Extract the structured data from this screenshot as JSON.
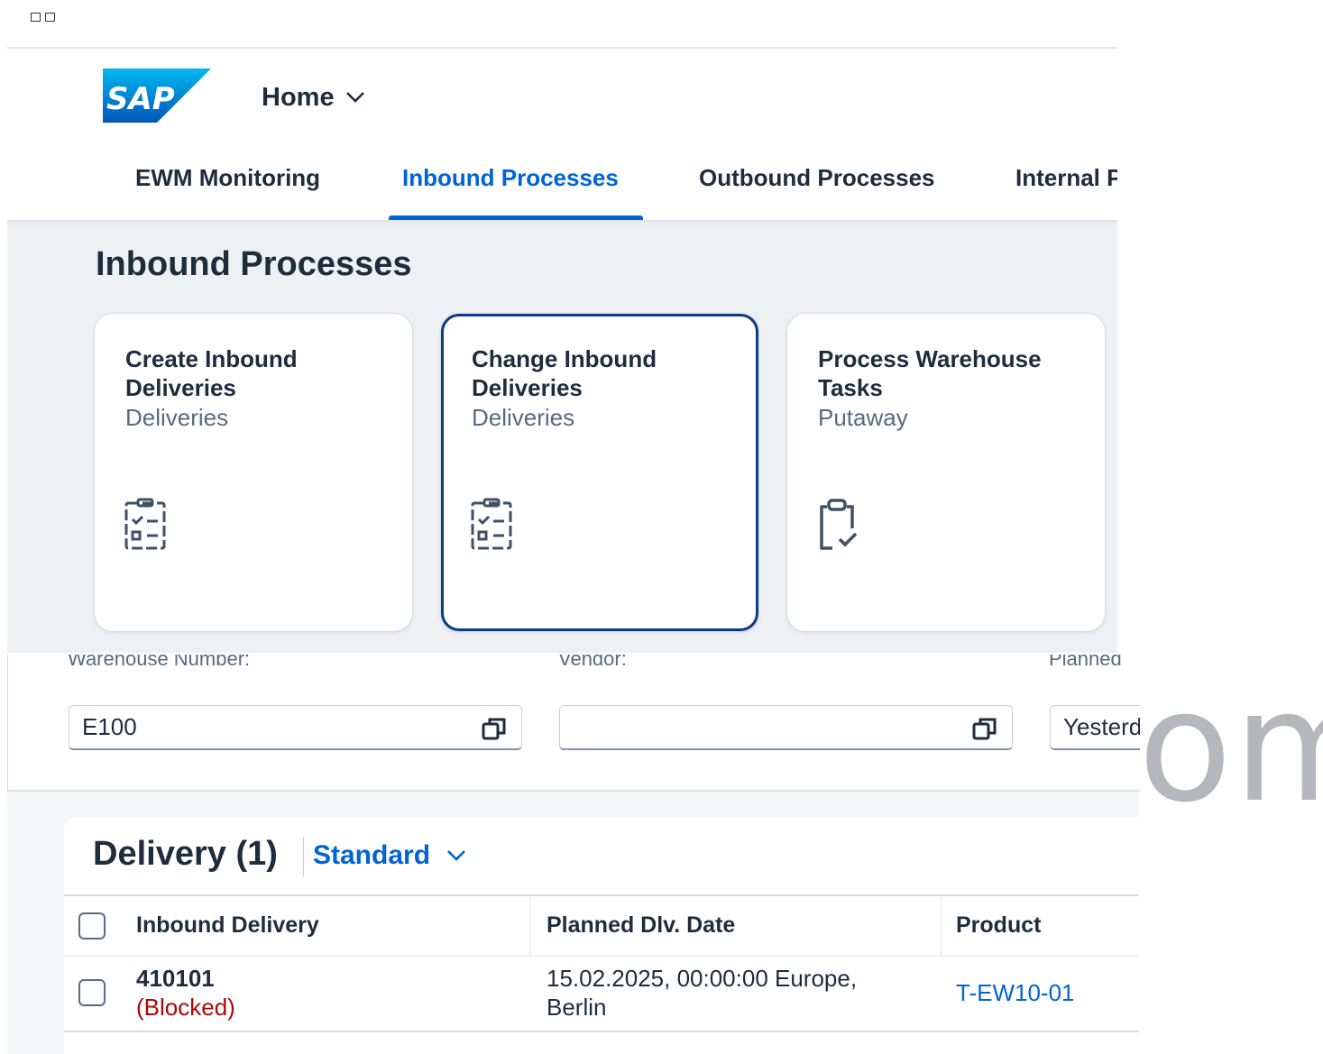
{
  "shell": {
    "logo_text": "SAP",
    "home_label": "Home"
  },
  "tabs": [
    {
      "label": "EWM Monitoring",
      "active": false
    },
    {
      "label": "Inbound Processes",
      "active": true
    },
    {
      "label": "Outbound Processes",
      "active": false
    },
    {
      "label": "Internal Processes",
      "active": false
    }
  ],
  "section": {
    "title": "Inbound Processes",
    "tiles": [
      {
        "title": "Create Inbound Deliveries",
        "subtitle": "Deliveries",
        "icon": "checklist-icon",
        "selected": false
      },
      {
        "title": "Change Inbound Deliveries",
        "subtitle": "Deliveries",
        "icon": "checklist-icon",
        "selected": true
      },
      {
        "title": "Process Warehouse Tasks",
        "subtitle": "Putaway",
        "icon": "clipboard-check-icon",
        "selected": false
      }
    ]
  },
  "filters": {
    "warehouse": {
      "label": "Warehouse Number:",
      "value": "E100"
    },
    "vendor": {
      "label": "Vendor:",
      "value": ""
    },
    "planned": {
      "label": "Planned",
      "value": "Yesterday"
    }
  },
  "watermark": "om",
  "table": {
    "title": "Delivery (1)",
    "variant": "Standard",
    "columns": [
      "Inbound Delivery",
      "Planned Dlv. Date",
      "Product"
    ],
    "rows": [
      {
        "delivery": "410101",
        "status": "(Blocked)",
        "date_line1": "15.02.2025, 00:00:00 Europe,",
        "date_line2": "Berlin",
        "product": "T-EW10-01"
      }
    ]
  },
  "colors": {
    "accent": "#0064d9",
    "selected_border": "#0a3c8c",
    "negative": "#aa0808",
    "section_bg": "#eef1f4"
  }
}
